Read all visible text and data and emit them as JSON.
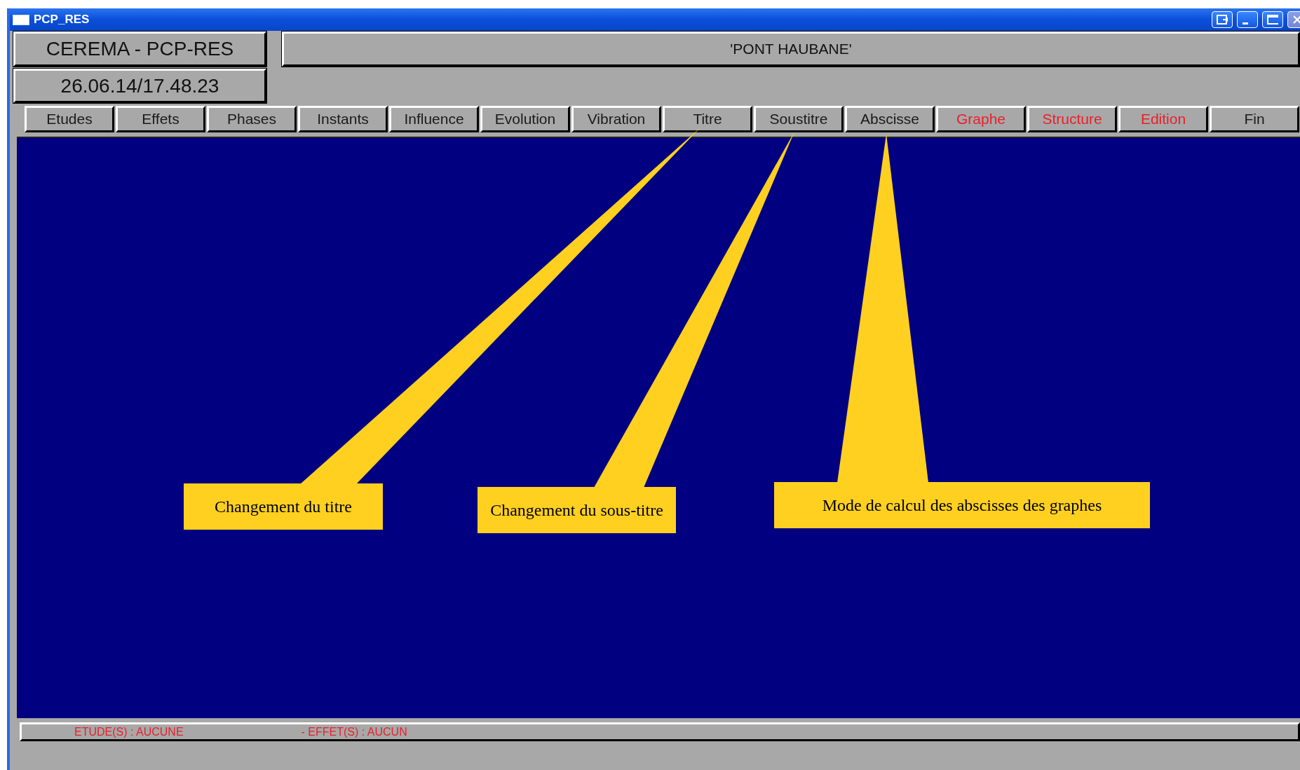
{
  "window": {
    "title": "PCP_RES"
  },
  "header": {
    "app_name": "CEREMA - PCP-RES",
    "project_title": "'PONT HAUBANE'",
    "timestamp": "26.06.14/17.48.23"
  },
  "menu": [
    {
      "label": "Etudes",
      "color": "#1a1a1a"
    },
    {
      "label": "Effets",
      "color": "#1a1a1a"
    },
    {
      "label": "Phases",
      "color": "#1a1a1a"
    },
    {
      "label": "Instants",
      "color": "#1a1a1a"
    },
    {
      "label": "Influence",
      "color": "#1a1a1a"
    },
    {
      "label": "Evolution",
      "color": "#1a1a1a"
    },
    {
      "label": "Vibration",
      "color": "#1a1a1a"
    },
    {
      "label": "Titre",
      "color": "#1a1a1a"
    },
    {
      "label": "Soustitre",
      "color": "#1a1a1a"
    },
    {
      "label": "Abscisse",
      "color": "#1a1a1a"
    },
    {
      "label": "Graphe",
      "color": "#e8202a"
    },
    {
      "label": "Structure",
      "color": "#e8202a"
    },
    {
      "label": "Edition",
      "color": "#e8202a"
    },
    {
      "label": "Fin",
      "color": "#1a1a1a"
    }
  ],
  "callouts": [
    {
      "text": "Changement du titre"
    },
    {
      "text": "Changement du sous-titre"
    },
    {
      "text": "Mode de calcul des abscisses des graphes"
    }
  ],
  "status_bar": [
    "ETUDE(S) : AUCUNE",
    "- EFFET(S) : AUCUN"
  ]
}
